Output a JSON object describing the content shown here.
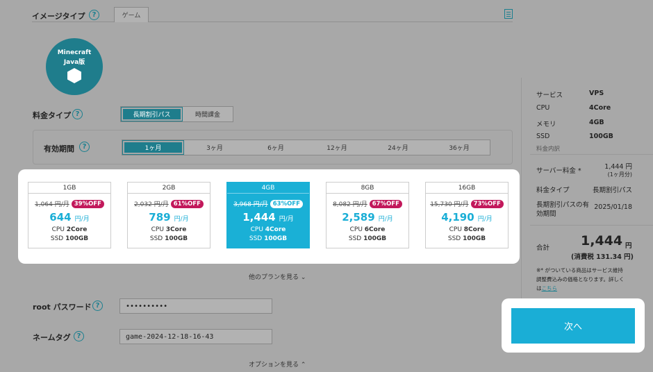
{
  "image_type": {
    "label": "イメージタイプ",
    "help": "?",
    "tab": "ゲーム",
    "doc_icon": "document-icon"
  },
  "game_logo": {
    "line1": "Minecraft",
    "line2": "Java版"
  },
  "fee_type": {
    "label": "料金タイプ",
    "help": "?",
    "options": [
      "長期割引パス",
      "時間課金"
    ],
    "selected": "長期割引パス"
  },
  "period": {
    "label": "有効期間",
    "help": "?",
    "options": [
      "1ヶ月",
      "3ヶ月",
      "6ヶ月",
      "12ヶ月",
      "24ヶ月",
      "36ヶ月"
    ],
    "selected": "1ヶ月"
  },
  "plans": [
    {
      "mem": "1GB",
      "old": "1,064 円/月",
      "off": "39%OFF",
      "price": "644",
      "unit": "円/月",
      "cpu_label": "CPU",
      "cpu": "2Core",
      "ssd_label": "SSD",
      "ssd": "100GB"
    },
    {
      "mem": "2GB",
      "old": "2,032 円/月",
      "off": "61%OFF",
      "price": "789",
      "unit": "円/月",
      "cpu_label": "CPU",
      "cpu": "3Core",
      "ssd_label": "SSD",
      "ssd": "100GB"
    },
    {
      "mem": "4GB",
      "old": "3,968 円/月",
      "off": "63%OFF",
      "price": "1,444",
      "unit": "円/月",
      "cpu_label": "CPU",
      "cpu": "4Core",
      "ssd_label": "SSD",
      "ssd": "100GB"
    },
    {
      "mem": "8GB",
      "old": "8,082 円/月",
      "off": "67%OFF",
      "price": "2,589",
      "unit": "円/月",
      "cpu_label": "CPU",
      "cpu": "6Core",
      "ssd_label": "SSD",
      "ssd": "100GB"
    },
    {
      "mem": "16GB",
      "old": "15,730 円/月",
      "off": "73%OFF",
      "price": "4,190",
      "unit": "円/月",
      "cpu_label": "CPU",
      "cpu": "8Core",
      "ssd_label": "SSD",
      "ssd": "100GB"
    }
  ],
  "selected_plan": "4GB",
  "more_plans": "他のプランを見る",
  "root_password": {
    "label": "root パスワード",
    "help": "?",
    "value": "••••••••••"
  },
  "name_tag": {
    "label": "ネームタグ",
    "help": "?",
    "value": "game-2024-12-18-16-43"
  },
  "options_link": "オプションを見る",
  "summary": {
    "service_label": "サービス",
    "service": "VPS",
    "cpu_label": "CPU",
    "cpu": "4Core",
    "mem_label": "メモリ",
    "mem": "4GB",
    "ssd_label": "SSD",
    "ssd": "100GB",
    "breakdown": "料金内訳",
    "server_fee_label": "サーバー料金 *",
    "server_fee": "1,444 円",
    "server_fee_note": "(1ヶ月分)",
    "fee_type_label": "料金タイプ",
    "fee_type": "長期割引パス",
    "expiry_label_1": "長期割引パスの有",
    "expiry_label_2": "効期間",
    "expiry": "2025/01/18",
    "total_label": "合計",
    "total": "1,444",
    "total_unit": "円",
    "tax": "(消費税 131.34 円)",
    "note_1": "※* がついている商品はサービス維持",
    "note_2": "調整費込みの価格となります。詳しく",
    "note_3": "は",
    "note_link": "こちら"
  },
  "next_button": "次へ"
}
